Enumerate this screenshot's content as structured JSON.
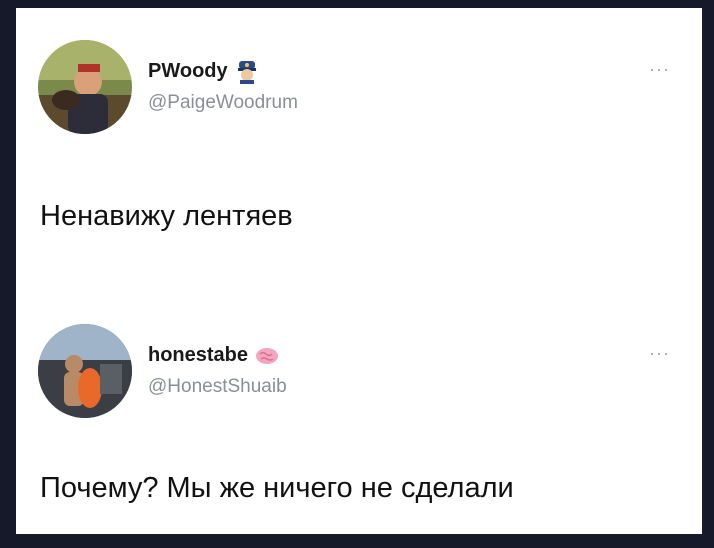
{
  "tweets": [
    {
      "display_name": "PWoody",
      "name_emoji": "police-officer-emoji-icon",
      "handle": "@PaigeWoodrum",
      "more": "···",
      "text": "Ненавижу лентяев"
    },
    {
      "display_name": "honestabe",
      "name_emoji": "brain-emoji-icon",
      "handle": "@HonestShuaib",
      "more": "···",
      "text": "Почему? Мы же ничего не сделали"
    }
  ],
  "colors": {
    "background": "#15192a",
    "card": "#ffffff",
    "handle": "#8a8f96"
  }
}
